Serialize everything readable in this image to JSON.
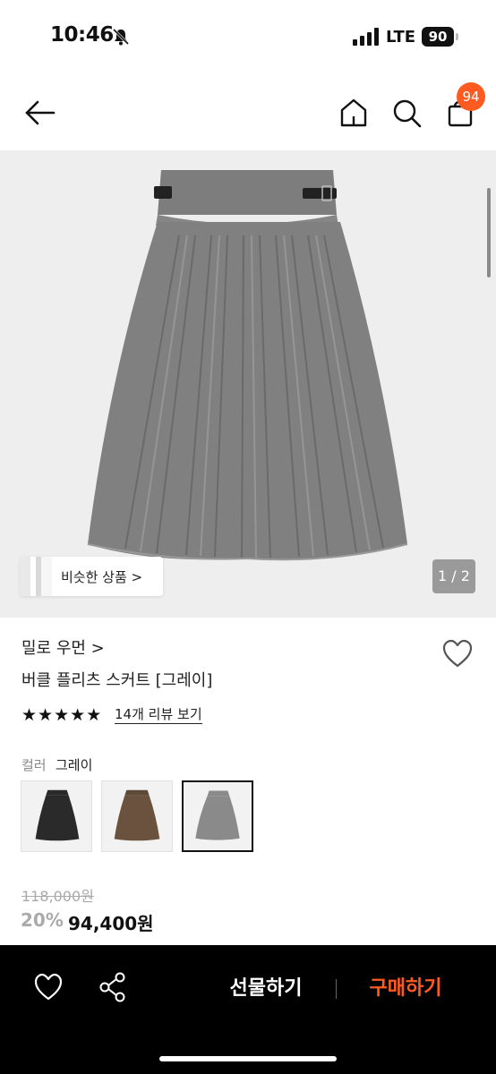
{
  "status_bar": {
    "time": "10:46",
    "network": "LTE",
    "battery": "90",
    "icons": [
      "bell-slash-icon",
      "signal-bars-icon"
    ]
  },
  "nav": {
    "cart_badge": "94",
    "icons": [
      "back-arrow-icon",
      "home-icon",
      "search-icon",
      "shopping-bag-icon"
    ]
  },
  "gallery": {
    "similar_products_label": "비슷한 상품 >",
    "page_indicator": "1 / 2"
  },
  "product": {
    "brand": "밀로 우먼 >",
    "name": "버클 플리츠 스커트 [그레이]",
    "rating_stars": 5,
    "review_link": "14개 리뷰 보기",
    "color_label": "컬러",
    "color_value": "그레이",
    "color_options": [
      {
        "name": "black",
        "color": "#2a2a2a",
        "selected": false
      },
      {
        "name": "brown",
        "color": "#6a523e",
        "selected": false
      },
      {
        "name": "gray",
        "color": "#8a8a8a",
        "selected": true
      }
    ]
  },
  "price": {
    "original": "118,000원",
    "discount": "20%",
    "final": "94,400원"
  },
  "bottom_bar": {
    "gift_label": "선물하기",
    "buy_label": "구매하기",
    "icons": [
      "heart-icon",
      "share-icon"
    ]
  },
  "colors": {
    "accent": "#ff5a1f",
    "bottom_bar_bg": "#000000"
  }
}
